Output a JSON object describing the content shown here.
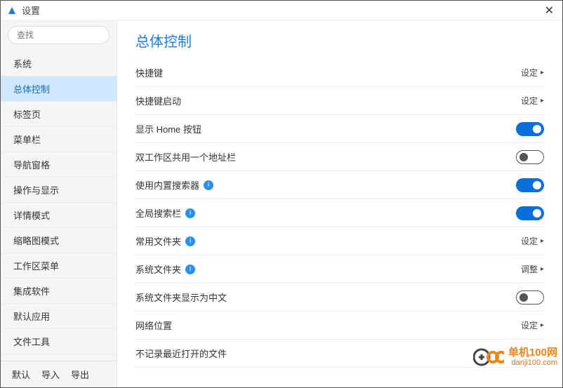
{
  "window": {
    "title": "设置"
  },
  "search": {
    "placeholder": "查找"
  },
  "sidebar": {
    "items": [
      {
        "label": "系统"
      },
      {
        "label": "总体控制"
      },
      {
        "label": "标签页"
      },
      {
        "label": "菜单栏"
      },
      {
        "label": "导航窗格"
      },
      {
        "label": "操作与显示"
      },
      {
        "label": "详情模式"
      },
      {
        "label": "缩略图模式"
      },
      {
        "label": "工作区菜单"
      },
      {
        "label": "集成软件"
      },
      {
        "label": "默认应用"
      },
      {
        "label": "文件工具"
      }
    ],
    "activeIndex": 1,
    "footer": {
      "default": "默认",
      "import": "导入",
      "export": "导出"
    }
  },
  "page": {
    "title": "总体控制",
    "settings": [
      {
        "label": "快捷键",
        "control": "link",
        "linkText": "设定",
        "info": false
      },
      {
        "label": "快捷键启动",
        "control": "link",
        "linkText": "设定",
        "info": false
      },
      {
        "label": "显示 Home 按钮",
        "control": "toggle",
        "on": true,
        "info": false
      },
      {
        "label": "双工作区共用一个地址栏",
        "control": "toggle",
        "on": false,
        "info": false
      },
      {
        "label": "使用内置搜索器",
        "control": "toggle",
        "on": true,
        "info": true
      },
      {
        "label": "全局搜索栏",
        "control": "toggle",
        "on": true,
        "info": true
      },
      {
        "label": "常用文件夹",
        "control": "link",
        "linkText": "设定",
        "info": true
      },
      {
        "label": "系统文件夹",
        "control": "link",
        "linkText": "调整",
        "info": true
      },
      {
        "label": "系统文件夹显示为中文",
        "control": "toggle",
        "on": false,
        "info": false
      },
      {
        "label": "网络位置",
        "control": "link",
        "linkText": "设定",
        "info": false
      },
      {
        "label": "不记录最近打开的文件",
        "control": "toggle",
        "on": null,
        "info": false
      }
    ]
  },
  "watermark": {
    "line1": "单机100网",
    "line2": "danji100.com"
  }
}
